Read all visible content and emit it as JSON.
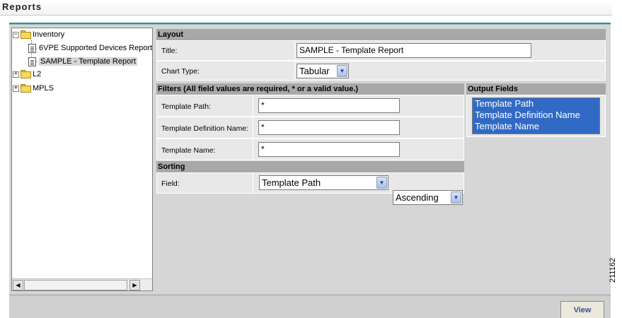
{
  "header": {
    "title": "Reports"
  },
  "tree": {
    "items": [
      {
        "label": "Inventory",
        "expander": "−"
      },
      {
        "label": "6VPE Supported Devices Report"
      },
      {
        "label": "SAMPLE - Template Report"
      },
      {
        "label": "L2",
        "expander": "+"
      },
      {
        "label": "MPLS",
        "expander": "+"
      }
    ]
  },
  "layout": {
    "header": "Layout",
    "title_label": "Title:",
    "title_value": "SAMPLE - Template Report",
    "chart_type_label": "Chart Type:",
    "chart_type_value": "Tabular"
  },
  "filters": {
    "header": "Filters (All field values are required, * or a valid value.)",
    "template_path_label": "Template Path:",
    "template_path_value": "*",
    "template_definition_name_label": "Template Definition Name:",
    "template_definition_name_value": "*",
    "template_name_label": "Template Name:",
    "template_name_value": "*"
  },
  "sorting": {
    "header": "Sorting",
    "field_label": "Field:",
    "field_value": "Template Path",
    "order_value": "Ascending"
  },
  "output_fields": {
    "header": "Output Fields",
    "items": [
      "Template Path",
      "Template Definition Name",
      "Template Name"
    ]
  },
  "actions": {
    "view_label": "View"
  },
  "figure_id": "211162",
  "icons": {
    "dropdown": "chevron-down-icon",
    "folder": "folder-icon",
    "document": "document-icon",
    "scroll_left": "scroll-left-icon",
    "scroll_right": "scroll-right-icon"
  },
  "colors": {
    "accent_line": "#3a8c8c",
    "section_header": "#a8a8a8",
    "selection": "#316ac5",
    "view_text": "#3a4f8a"
  }
}
